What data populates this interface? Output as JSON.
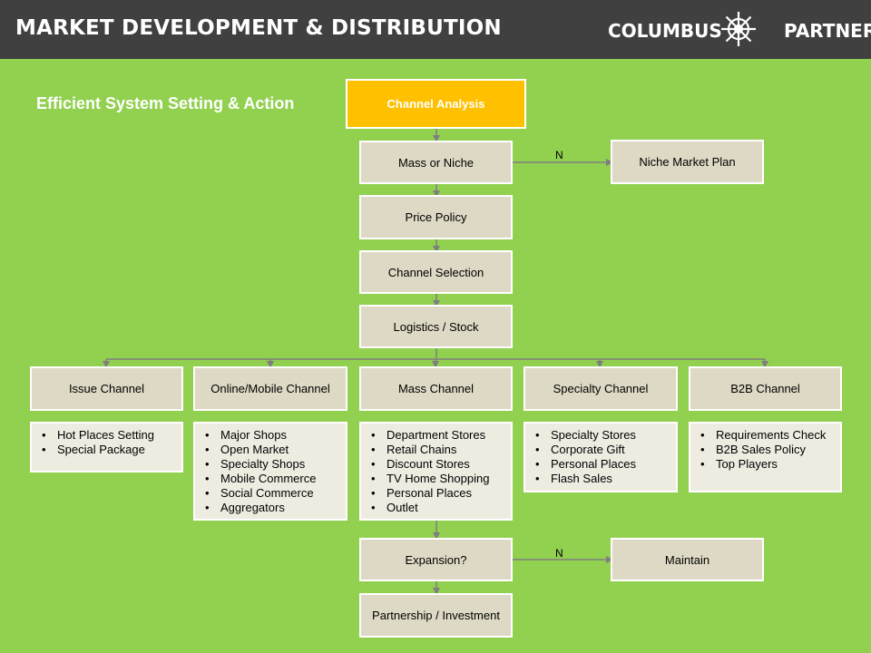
{
  "header": {
    "title": "MARKET DEVELOPMENT & DISTRIBUTION",
    "logo_left": "COLUMBUS",
    "logo_right": "PARTNER"
  },
  "subtitle": "Efficient System Setting & Action",
  "colors": {
    "background": "#92d050",
    "header": "#404040",
    "highlight": "#ffc000",
    "box": "#ddd9c4",
    "list_box": "#eeece1",
    "connector": "#7f7f7f"
  },
  "flow": {
    "channel_analysis": "Channel Analysis",
    "mass_or_niche": "Mass or Niche",
    "niche_market_plan": "Niche Market Plan",
    "price_policy": "Price Policy",
    "channel_selection": "Channel Selection",
    "logistics_stock": "Logistics / Stock",
    "expansion": "Expansion?",
    "maintain": "Maintain",
    "partnership": "Partnership / Investment",
    "no_label_1": "N",
    "no_label_2": "N"
  },
  "channels": [
    {
      "title": "Issue Channel",
      "items": [
        "Hot Places Setting",
        "Special Package"
      ]
    },
    {
      "title": "Online/Mobile Channel",
      "items": [
        "Major Shops",
        "Open Market",
        "Specialty Shops",
        "Mobile Commerce",
        "Social Commerce",
        "Aggregators"
      ]
    },
    {
      "title": "Mass Channel",
      "items": [
        "Department Stores",
        "Retail Chains",
        "Discount Stores",
        "TV Home Shopping",
        "Personal Places",
        "Outlet"
      ]
    },
    {
      "title": "Specialty Channel",
      "items": [
        "Specialty Stores",
        "Corporate  Gift",
        "Personal Places",
        "Flash Sales"
      ]
    },
    {
      "title": "B2B Channel",
      "items": [
        "Requirements Check",
        "B2B Sales Policy",
        "Top Players"
      ]
    }
  ]
}
